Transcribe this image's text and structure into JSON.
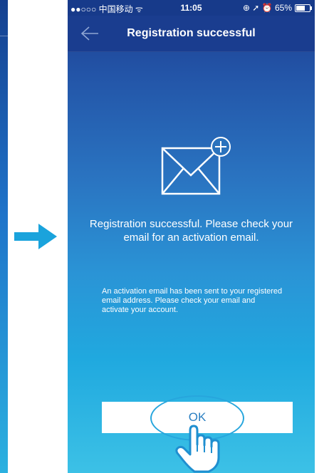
{
  "status_bar": {
    "carrier": "●●○○○ 中国移动 ᯤ",
    "time": "11:05",
    "indicators": "⊕ ➚ ⏰ 65%"
  },
  "nav": {
    "title": "Registration successful",
    "back_icon": "back-arrow-icon"
  },
  "content": {
    "headline": "Registration successful. Please check your email for an activation email.",
    "body": "An activation email has been sent to your registered email address. Please check your email and activate your account.",
    "mail_icon": "envelope-plus-icon"
  },
  "action": {
    "ok_label": "OK"
  },
  "annotations": {
    "arrow": "right-arrow",
    "hand": "tap-hand-icon"
  },
  "colors": {
    "accent": "#27a6dd",
    "nav_bg": "#1a3d8f",
    "button_text": "#2a7fc2"
  }
}
